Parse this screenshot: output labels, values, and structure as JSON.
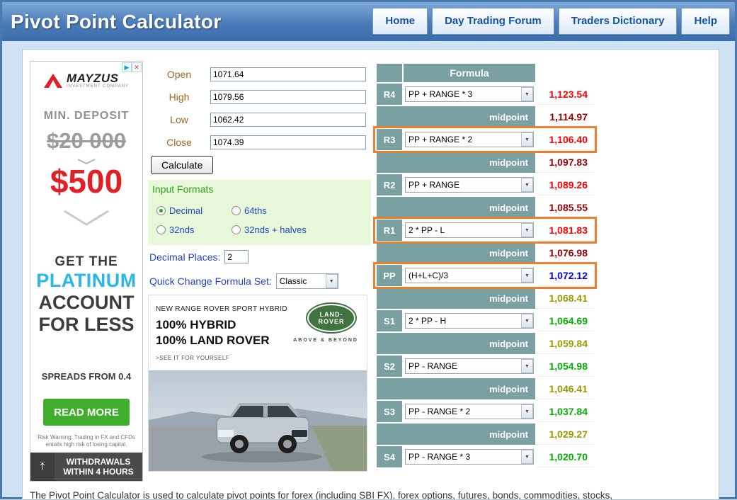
{
  "header": {
    "title": "Pivot Point Calculator",
    "nav": [
      "Home",
      "Day Trading Forum",
      "Traders Dictionary",
      "Help"
    ]
  },
  "form": {
    "fields": [
      {
        "label": "Open",
        "value": "1071.64"
      },
      {
        "label": "High",
        "value": "1079.56"
      },
      {
        "label": "Low",
        "value": "1062.42"
      },
      {
        "label": "Close",
        "value": "1074.39"
      }
    ],
    "calculate_label": "Calculate",
    "input_formats_title": "Input Formats",
    "format_options": [
      "Decimal",
      "64ths",
      "32nds",
      "32nds + halves"
    ],
    "selected_format": "Decimal",
    "decimal_places_label": "Decimal Places:",
    "decimal_places_value": "2",
    "quick_change_label": "Quick Change Formula Set:",
    "quick_change_value": "Classic"
  },
  "table": {
    "header_label": "Formula",
    "rows": [
      {
        "label": "R4",
        "formula": "PP + RANGE * 3",
        "value": "1,123.54"
      },
      {
        "label": "midpoint",
        "value": "1,114.97"
      },
      {
        "label": "R3",
        "formula": "PP + RANGE * 2",
        "value": "1,106.40"
      },
      {
        "label": "midpoint",
        "value": "1,097.83"
      },
      {
        "label": "R2",
        "formula": "PP + RANGE",
        "value": "1,089.26"
      },
      {
        "label": "midpoint",
        "value": "1,085.55"
      },
      {
        "label": "R1",
        "formula": "2 * PP - L",
        "value": "1,081.83"
      },
      {
        "label": "midpoint",
        "value": "1,076.98"
      },
      {
        "label": "PP",
        "formula": "(H+L+C)/3",
        "value": "1,072.12"
      },
      {
        "label": "midpoint",
        "value": "1,068.41"
      },
      {
        "label": "S1",
        "formula": "2 * PP - H",
        "value": "1,064.69"
      },
      {
        "label": "midpoint",
        "value": "1,059.84"
      },
      {
        "label": "S2",
        "formula": "PP - RANGE",
        "value": "1,054.98"
      },
      {
        "label": "midpoint",
        "value": "1,046.41"
      },
      {
        "label": "S3",
        "formula": "PP - RANGE * 2",
        "value": "1,037.84"
      },
      {
        "label": "midpoint",
        "value": "1,029.27"
      },
      {
        "label": "S4",
        "formula": "PP - RANGE * 3",
        "value": "1,020.70"
      }
    ]
  },
  "ads": {
    "left": {
      "brand": "MAYZUS",
      "brand_sub": "INVESTMENT COMPANY",
      "min_deposit": "MIN. DEPOSIT",
      "old_amount": "$20 000",
      "new_amount": "$500",
      "get_the": "GET THE",
      "platinum": "PLATINUM",
      "account": "ACCOUNT",
      "for_less": "FOR LESS",
      "spreads": "SPREADS FROM 0.4",
      "cta": "READ MORE",
      "risk_warning": "Risk Warning: Trading in FX and CFDs entails high risk of losing capital.",
      "footer_line1": "WITHDRAWALS",
      "footer_line2": "WITHIN 4 HOURS"
    },
    "car": {
      "line1": "NEW RANGE ROVER SPORT HYBRID",
      "line2": "100% HYBRID",
      "line3": "100% LAND ROVER",
      "cta": ">SEE IT FOR YOURSELF",
      "logo_line1": "LAND-",
      "logo_line2": "ROVER",
      "tagline": "ABOVE & BEYOND"
    }
  },
  "footer_text": "The Pivot Point Calculator is used to calculate pivot points for forex (including SBI FX), forex options, futures, bonds, commodities, stocks,",
  "colors": {
    "accent-orange": "#e8802e",
    "teal": "#7aa0a2",
    "resistance": "#ff0000",
    "resistance-mid": "#980000",
    "pivot": "#0000e6",
    "support": "#00b000",
    "support-mid": "#9a9a00",
    "nav-text": "#1553a8",
    "label-gold": "#9c6a1f",
    "label-blue": "#2244cc",
    "green-title": "#33a01c"
  }
}
